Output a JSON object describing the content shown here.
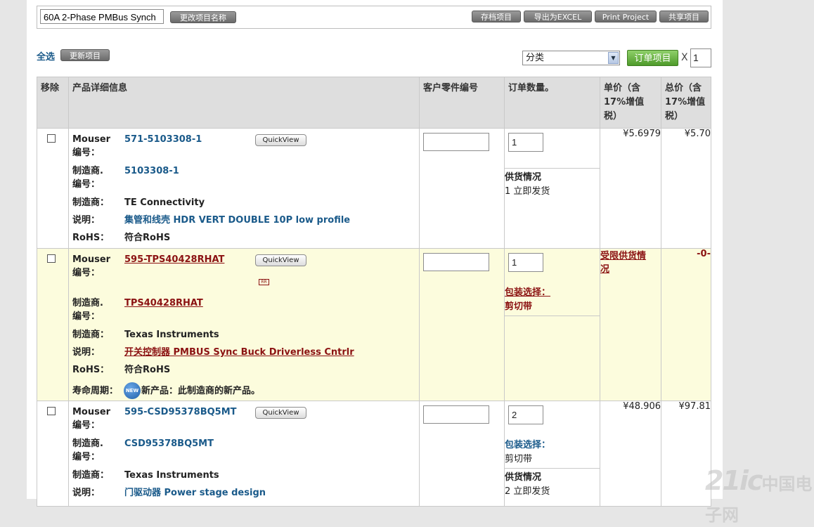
{
  "header": {
    "project_name": "60A 2-Phase PMBus Synch",
    "rename_btn": "更改项目名称",
    "save_btn": "存档项目",
    "export_btn": "导出为EXCEL",
    "print_btn": "Print Project",
    "share_btn": "共享项目"
  },
  "toolbar": {
    "select_all": "全选",
    "update_btn": "更新项目",
    "category_selected": "分类",
    "order_btn": "订单项目",
    "times": "X",
    "order_qty": "1"
  },
  "table": {
    "headers": [
      "移除",
      "产品详细信息",
      "客户零件编号",
      "订单数量。",
      "单价（含17%增值税）",
      "总价（含17%增值税）"
    ],
    "header_lines": {
      "unit": [
        "单价（含",
        "17%增值",
        "税）"
      ],
      "total": [
        "总价（含",
        "17%增值",
        "税）"
      ]
    },
    "labels": {
      "mouser_no": [
        "Mouser",
        "编号："
      ],
      "mfr_no": [
        "制造商.",
        "编号："
      ],
      "mfr": "制造商：",
      "desc": "说明：",
      "rohs": "RoHS：",
      "lifecycle": "寿命周期："
    },
    "quickview": "QuickView",
    "rows": [
      {
        "mouser_no": "571-5103308-1",
        "mfr_no": "5103308-1",
        "manufacturer": "TE Connectivity",
        "description": "集管和线壳 HDR VERT DOUBLE 10P low profile",
        "rohs": "符合RoHS",
        "qty": "1",
        "availability_label": "供货情况",
        "availability": "1 立即发货",
        "unit_price": "¥5.6979",
        "total_price": "¥5.70"
      },
      {
        "mouser_no": "595-TPS40428RHAT",
        "rr_icon": "RR",
        "mfr_no": "TPS40428RHAT",
        "manufacturer": "Texas Instruments",
        "description": "开关控制器 PMBUS Sync Buck Driverless Cntrlr",
        "rohs": "符合RoHS",
        "lifecycle_badge": "NEW",
        "lifecycle": "新产品：此制造商的新产品。",
        "qty": "1",
        "pkg_label": "包装选择：",
        "pkg_value": "剪切带",
        "restricted": [
          "受限供货情",
          "况"
        ],
        "total_price": "-0-"
      },
      {
        "mouser_no": "595-CSD95378BQ5MT",
        "mfr_no": "CSD95378BQ5MT",
        "manufacturer": "Texas Instruments",
        "description": "门驱动器 Power stage design",
        "qty": "2",
        "pkg_label": "包装选择：",
        "pkg_value": "剪切带",
        "availability_label": "供货情况",
        "availability": "2 立即发货",
        "unit_price": "¥48.906",
        "total_price": "¥97.81"
      }
    ]
  },
  "watermark": {
    "latin": "21ic",
    "cn": "中国电子网"
  }
}
